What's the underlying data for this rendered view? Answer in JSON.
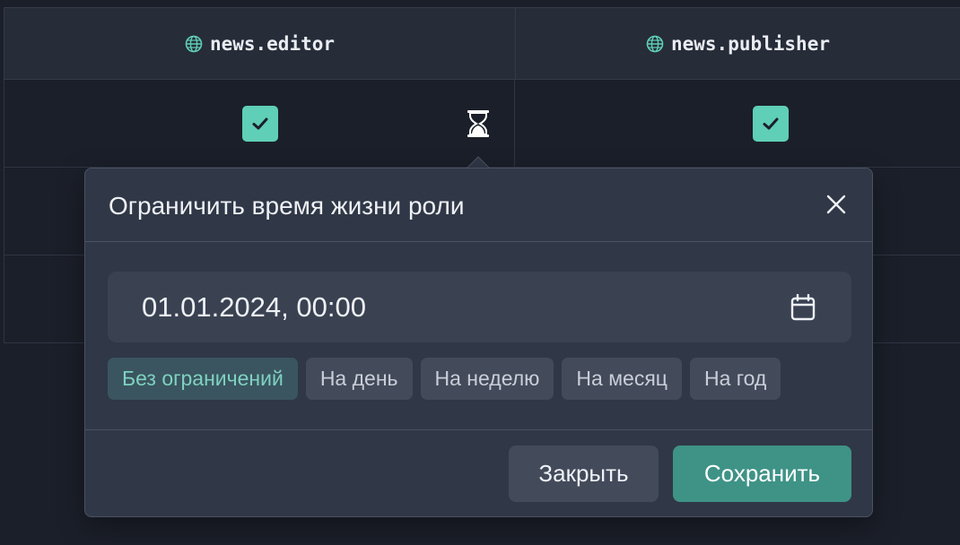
{
  "table": {
    "columns": [
      {
        "label": "news.editor",
        "icon": "globe-icon"
      },
      {
        "label": "news.publisher",
        "icon": "globe-icon"
      }
    ],
    "row1": {
      "editor_checked": true,
      "publisher_checked": true
    }
  },
  "popover": {
    "title": "Ограничить время жизни роли",
    "date_value": "01.01.2024, 00:00",
    "presets": [
      "Без ограничений",
      "На день",
      "На неделю",
      "На месяц",
      "На год"
    ],
    "active_preset": "Без ограничений",
    "close_label": "Закрыть",
    "save_label": "Сохранить"
  },
  "colors": {
    "background": "#1b1f29",
    "header": "#262c38",
    "popover": "#303746",
    "accent": "#5fcfb7",
    "save": "#3e9386"
  }
}
